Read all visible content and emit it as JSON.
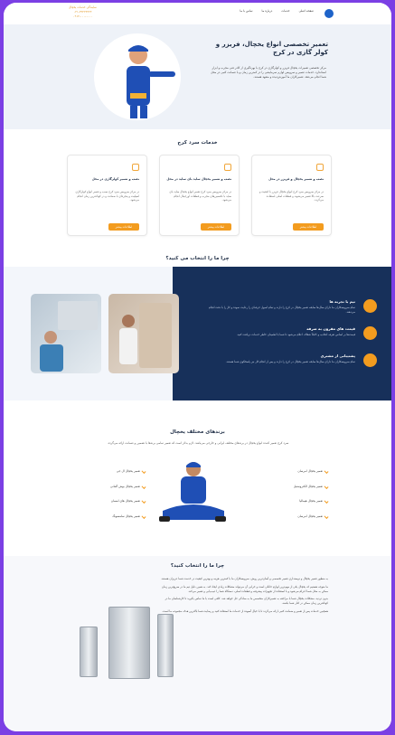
{
  "header": {
    "nav": [
      "صفحه اصلی",
      "خدمات",
      "درباره ما",
      "تماس با ما"
    ],
    "contact_lines": [
      "نمایندگی خدمات یخچال",
      "۰۲۱-۲۲۲۲۲۲۲۲",
      "۰۹۱۲-۰۰۰-۰۰۰۰"
    ]
  },
  "hero": {
    "title": "تعمیر تخصصی انواع یخچال، فریزر و کولر گازی در کرج",
    "text": "مرکز تخصصی تعمیرات یخچال فریزر و کولرگازی در کرج با بهره‌گیری از کادر فنی مجرب و ابزار استاندارد، خدمات تعمیر و سرویس لوازم سرمایشی را در کمترین زمان و با ضمانت کتبی در محل شما انجام می‌دهد. تعمیرکاران ما آموزش‌دیده و متعهد هستند."
  },
  "services": {
    "title": "خدمات سرد کرج",
    "cards": [
      {
        "title": "نصب و تعمیر یخچال و فریزر در محل",
        "text": "در مرکز سرویس سرد کرج انواع یخچال فریزر با کیفیت و سرعت بالا تعمیر می‌شوند و قطعات اصلی استفاده می‌گردد.",
        "button": "اطلاعات بیشتر"
      },
      {
        "title": "نصب و تعمیر یخچال ساید بای ساید در محل",
        "text": "در مرکز سرویس سرد کرج تعمیر انواع یخچال ساید بای ساید با تکنسین‌های مجرب و قطعات اورجینال انجام می‌شود.",
        "button": "اطلاعات بیشتر"
      },
      {
        "title": "نصب و تعمیر کولرگازی در محل",
        "text": "در مرکز سرویس سرد کرج نصب و تعمیر انواع کولرگازی اسپلیت و پنجره‌ای با ضمانت و در کوتاه‌ترین زمان انجام می‌شود.",
        "button": "اطلاعات بیشتر"
      }
    ]
  },
  "why": {
    "title": "چرا ما را انتخاب می کنید؟",
    "features": [
      {
        "title": "تیم با تجربه ها",
        "text": "تمام سرویسکاران ما دارای سال‌ها سابقه تعمیر یخچال در کرج را دارند و تمام اصول حرفه‌ای را رعایت نموده و کار را با دقت انجام می‌دهند."
      },
      {
        "title": "قیمت های مقرون به صرفه",
        "text": "قیمت‌ها بر اساس تعرفه اتحادیه و کاملاً شفاف اعلام می‌شود تا شما با اطمینان خاطر خدمات دریافت کنید."
      },
      {
        "title": "پشتیبانی از مشتری",
        "text": "تمام سرویسکاران ما دارای سال‌ها سابقه تعمیر یخچال در کرج را دارند و پس از انجام کار نیز پاسخگوی شما هستند."
      }
    ]
  },
  "brands": {
    "title": "برندهای مختلف یخچال",
    "subtitle": "سرد کرج تعمیر کننده انواع یخچال در برندهای مختلف ایرانی و خارجی می‌باشد. لازم بذکر است که تعمیر تمامی برندها با تضمین و ضمانت ارائه می‌گردد.",
    "right_col": [
      "تعمیر یخچال امرسان",
      "تعمیر یخچال الکتروستیل",
      "تعمیر یخچال هیمالیا",
      "تعمیر یخچال امرسان"
    ],
    "left_col": [
      "تعمیر یخچال ال جی",
      "تعمیر یخچال بوش آلمانی",
      "تعمیر یخچال های امسان",
      "تعمیر یخچال سامسونگ"
    ]
  },
  "bottom": {
    "title": "چرا ما را انتخاب کنید؟",
    "paragraphs": [
      "به منظور تعمیر یخچال و دوستداری تعمیر تخصصی و آسان‌ترین روش، سرویسکاران ما با کمترین هزینه و بهترین کیفیت در خدمت شما عزیزان هستند.",
      "ما متوجه هستیم که یخچال یکی از مهم‌ترین لوازم خانگی است و خرابی آن می‌تواند مشکلات زیادی ایجاد کند. به همین دلیل تیم ما در سریع‌ترین زمان ممکن به محل شما اعزام می‌شود و با استفاده از تجهیزات پیشرفته و قطعات اصلی، دستگاه شما را عیب‌یابی و تعمیر می‌کند.",
      "بدون تردید، مشکلات یخچال شما با مراجعه به تعمیرکاران متخصص ما به سادگی حل خواهد شد. کافی است با ما تماس بگیرید تا کارشناسان ما در کوتاه‌ترین زمان ممکن در کنار شما باشند.",
      "همچنین خدمات پس از تعمیر و ضمانت کتبی ارائه می‌گردد تا با خیال آسوده از خدمات ما استفاده کنید و رضایت شما بالاترین هدف مجموعه ما است."
    ]
  },
  "colors": {
    "accent": "#f39c1f",
    "navy": "#17305a",
    "frame": "#7b3fe4"
  }
}
